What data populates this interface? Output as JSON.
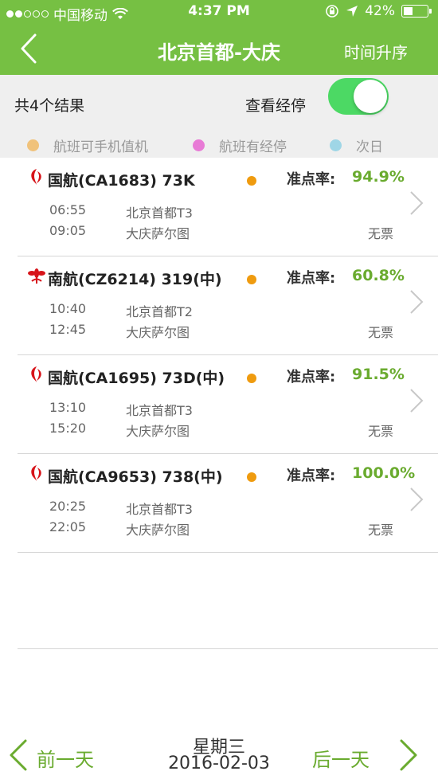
{
  "status_bar": {
    "carrier": "中国移动",
    "time": "4:37 PM",
    "battery": "42%",
    "battery_level": 0.42,
    "icons": [
      "signal-dots-icon",
      "wifi-icon",
      "rotation-lock-icon",
      "location-arrow-icon",
      "battery-icon"
    ]
  },
  "nav": {
    "back_icon": "back-chevron-icon",
    "title": "北京首都-大庆",
    "sort_label": "时间升序"
  },
  "filter": {
    "count_label": "共4个结果",
    "stops_label": "查看经停",
    "stops_toggle_on": true
  },
  "legend": [
    {
      "label": "航班可手机值机",
      "color": "#f0c27b"
    },
    {
      "label": "航班有经停",
      "color": "#e87bd6"
    },
    {
      "label": "次日",
      "color": "#9fd6e6"
    }
  ],
  "flights": [
    {
      "name": "国航(CA1683) 73K",
      "airline_icon": "air-china-logo-icon",
      "ontime_label": "准点率:",
      "ontime": "94.9%",
      "dep_time": "06:55",
      "arr_time": "09:05",
      "dep_airport": "北京首都T3",
      "arr_airport": "大庆萨尔图",
      "tickets": "无票"
    },
    {
      "name": "南航(CZ6214) 319(中)",
      "airline_icon": "china-southern-logo-icon",
      "ontime_label": "准点率:",
      "ontime": "60.8%",
      "dep_time": "10:40",
      "arr_time": "12:45",
      "dep_airport": "北京首都T2",
      "arr_airport": "大庆萨尔图",
      "tickets": "无票"
    },
    {
      "name": "国航(CA1695) 73D(中)",
      "airline_icon": "air-china-logo-icon",
      "ontime_label": "准点率:",
      "ontime": "91.5%",
      "dep_time": "13:10",
      "arr_time": "15:20",
      "dep_airport": "北京首都T3",
      "arr_airport": "大庆萨尔图",
      "tickets": "无票"
    },
    {
      "name": "国航(CA9653) 738(中)",
      "airline_icon": "air-china-logo-icon",
      "ontime_label": "准点率:",
      "ontime": "100.0%",
      "dep_time": "20:25",
      "arr_time": "22:05",
      "dep_airport": "北京首都T3",
      "arr_airport": "大庆萨尔图",
      "tickets": "无票"
    }
  ],
  "date_bar": {
    "prev_label": "前一天",
    "weekday": "星期三",
    "date": "2016-02-03",
    "next_label": "后一天"
  },
  "colors": {
    "header_green": "#76c043",
    "accent_green": "#6aab2f",
    "indicator_orange": "#ef9b0f",
    "toggle_green": "#4cd964"
  }
}
